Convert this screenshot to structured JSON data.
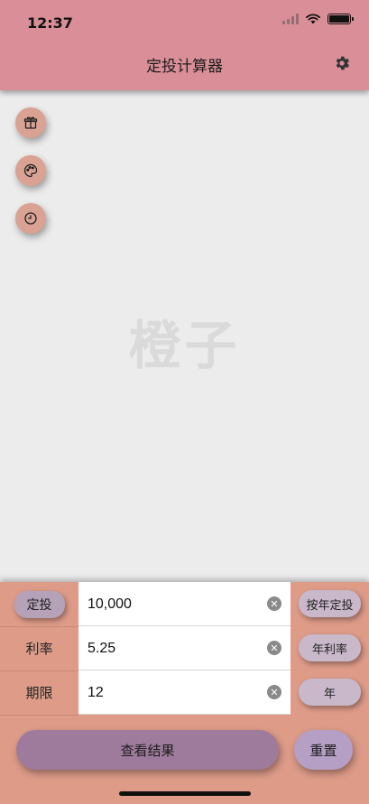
{
  "status_bar": {
    "time": "12:37"
  },
  "header": {
    "title": "定投计算器"
  },
  "side_buttons": [
    {
      "icon": "gift-icon"
    },
    {
      "icon": "palette-icon"
    },
    {
      "icon": "clock-icon"
    }
  ],
  "watermark": "橙子",
  "form": {
    "rows": [
      {
        "label": "定投",
        "value": "10,000",
        "unit": "按年定投"
      },
      {
        "label": "利率",
        "value": "5.25",
        "unit": "年利率"
      },
      {
        "label": "期限",
        "value": "12",
        "unit": "年"
      }
    ]
  },
  "actions": {
    "result_label": "查看结果",
    "reset_label": "重置"
  },
  "colors": {
    "header": "#d98e98",
    "panel": "#dd9b88",
    "result_button": "#9e7a9c",
    "reset_button": "#b59fc4",
    "side_button": "#d9a293"
  }
}
